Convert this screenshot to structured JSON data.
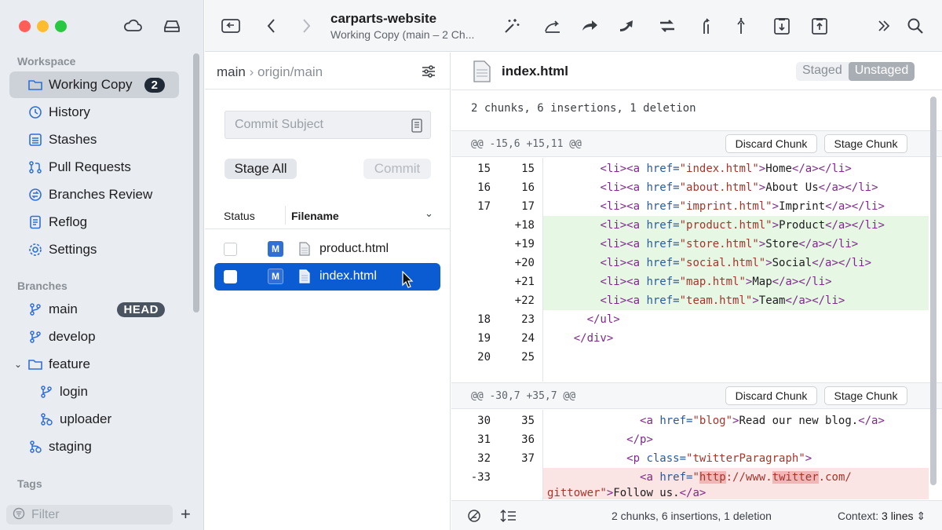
{
  "sidebar": {
    "workspace_header": "Workspace",
    "workspace_items": [
      {
        "label": "Working Copy",
        "badge": "2"
      },
      {
        "label": "History"
      },
      {
        "label": "Stashes"
      },
      {
        "label": "Pull Requests"
      },
      {
        "label": "Branches Review"
      },
      {
        "label": "Reflog"
      },
      {
        "label": "Settings"
      }
    ],
    "branches_header": "Branches",
    "branches": [
      {
        "label": "main",
        "badge": "HEAD"
      },
      {
        "label": "develop"
      },
      {
        "label": "feature"
      },
      {
        "label": "login"
      },
      {
        "label": "uploader"
      },
      {
        "label": "staging"
      }
    ],
    "tags_header": "Tags",
    "filter_placeholder": "Filter"
  },
  "toolbar": {
    "repo_name": "carparts-website",
    "subtitle": "Working Copy (main – 2 Ch..."
  },
  "commit_panel": {
    "branch": "main",
    "upstream": "origin/main",
    "subject_placeholder": "Commit Subject",
    "stage_all": "Stage All",
    "commit": "Commit",
    "col_status": "Status",
    "col_filename": "Filename",
    "files": [
      {
        "status": "M",
        "name": "product.html"
      },
      {
        "status": "M",
        "name": "index.html"
      }
    ]
  },
  "diff": {
    "filename": "index.html",
    "seg_staged": "Staged",
    "seg_unstaged": "Unstaged",
    "summary": "2 chunks, 6 insertions, 1 deletion",
    "discard_chunk": "Discard Chunk",
    "stage_chunk": "Stage Chunk",
    "chunk1_header": "@@ -15,6 +15,11 @@",
    "chunk2_header": "@@ -30,7 +35,7 @@",
    "footer_summary": "2 chunks, 6 insertions, 1 deletion",
    "context_label": "Context:",
    "context_value": "3 lines"
  }
}
